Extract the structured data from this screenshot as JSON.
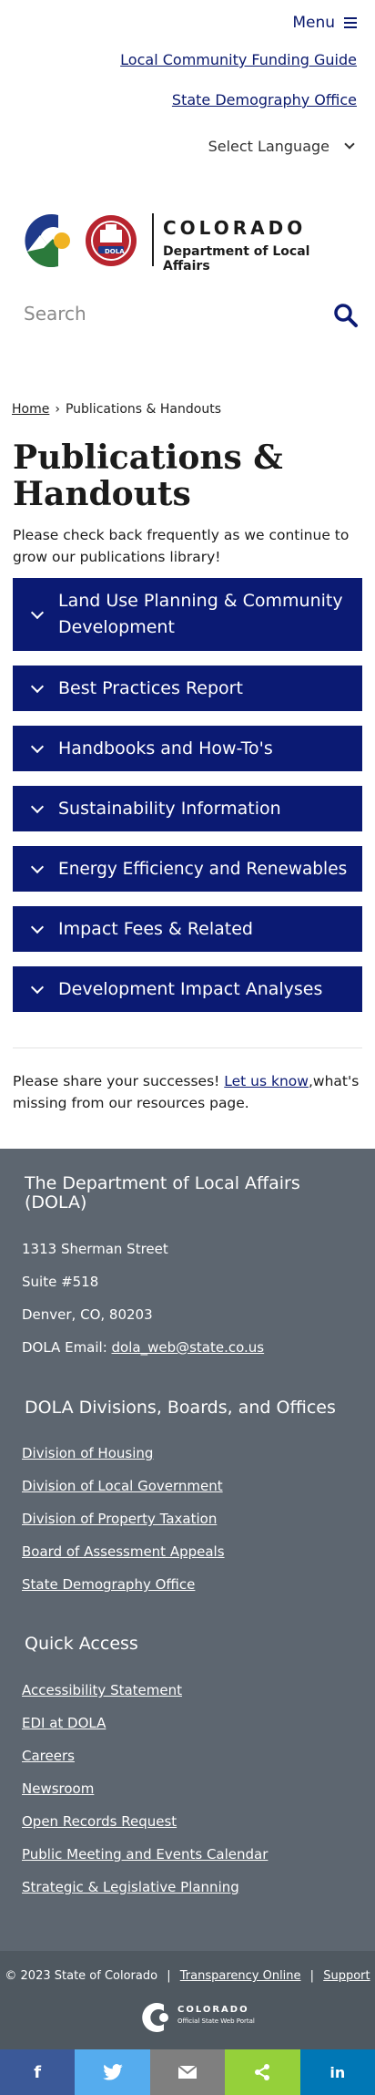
{
  "header": {
    "menu_label": "Menu",
    "links": [
      "Local Community Funding Guide",
      "State Demography Office"
    ],
    "language_label": "Select Language"
  },
  "logo": {
    "line1": "COLORADO",
    "line2": "Department of Local Affairs",
    "badge": "DOLA",
    "colors": {
      "blue": "#1f3a8a",
      "red": "#b8252f",
      "green": "#2b7a3b",
      "gold": "#f0b323"
    }
  },
  "search": {
    "placeholder": "Search"
  },
  "breadcrumb": {
    "home": "Home",
    "separator": "›",
    "current": "Publications & Handouts"
  },
  "page": {
    "title": "Publications & Handouts",
    "intro": "Please check back frequently as we continue to grow our publications library!"
  },
  "accordions": [
    "Land Use Planning & Community Development",
    "Best Practices Report",
    "Handbooks and How-To's",
    "Sustainability Information",
    "Energy Efficiency and Renewables",
    "Impact Fees & Related",
    "Development Impact Analyses"
  ],
  "share_text": {
    "before": "Please share your successes! ",
    "link": "Let us know",
    "after": ",what's missing from our resources page."
  },
  "footer": {
    "org_title": "The Department of Local Affairs (DOLA)",
    "address1": "1313 Sherman Street",
    "address2": "Suite  #518",
    "address3": "Denver, CO, 80203",
    "email_label": "DOLA Email: ",
    "email": "dola_web@state.co.us",
    "divisions_title": "DOLA Divisions, Boards, and Offices",
    "divisions": [
      "Division of Housing",
      "Division of Local Government",
      "Division of Property Taxation",
      "Board of Assessment Appeals",
      "State Demography Office"
    ],
    "quick_title": "Quick Access",
    "quick": [
      "Accessibility Statement",
      "EDI at DOLA",
      "Careers",
      "Newsroom",
      "Open Records Request",
      "Public Meeting and Events Calendar",
      "Strategic & Legislative Planning"
    ],
    "copyright": "© 2023 State of Colorado",
    "transparency": "Transparency Online",
    "support": "Support",
    "portal_line1": "COLORADO",
    "portal_line2": "Official State Web Portal",
    "bg_color": "#5d6670"
  },
  "sharebar": [
    {
      "label": "f",
      "icon": "facebook-icon",
      "color": "#3b5998"
    },
    {
      "label": "t",
      "icon": "twitter-icon",
      "color": "#55acee"
    },
    {
      "label": "✉",
      "icon": "email-icon",
      "color": "#7f7f7f"
    },
    {
      "label": "<",
      "icon": "share-icon",
      "color": "#95d03a"
    },
    {
      "label": "in",
      "icon": "linkedin-icon",
      "color": "#0077b5"
    }
  ]
}
